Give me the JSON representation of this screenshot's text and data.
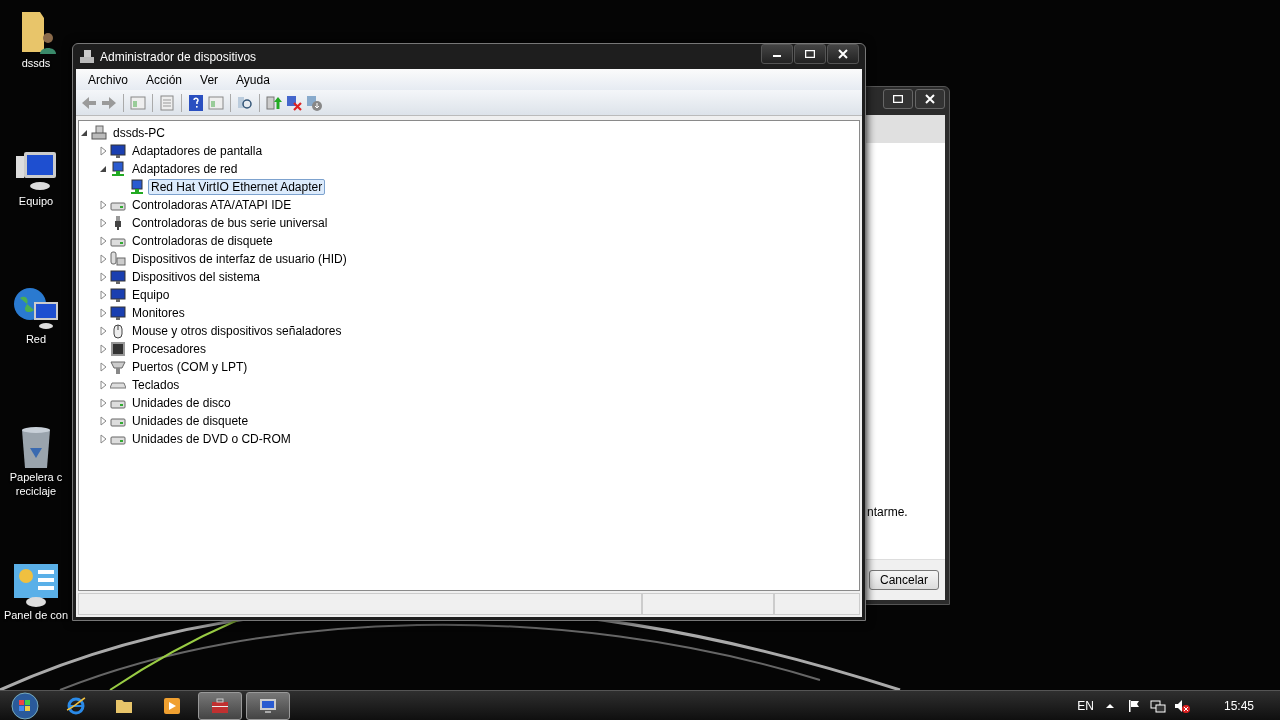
{
  "desktop_icons": [
    {
      "kind": "user-folder",
      "lines": [
        "dssds"
      ]
    },
    {
      "kind": "computer",
      "lines": [
        "Equipo"
      ]
    },
    {
      "kind": "network",
      "lines": [
        "Red"
      ]
    },
    {
      "kind": "recycle-bin",
      "lines": [
        "Papelera c",
        "reciclaje"
      ]
    },
    {
      "kind": "control-panel",
      "lines": [
        "Panel de con"
      ]
    }
  ],
  "dialog_behind": {
    "text": "ntarme.",
    "button": "Cancelar"
  },
  "window": {
    "title": "Administrador de dispositivos",
    "menu": [
      "Archivo",
      "Acción",
      "Ver",
      "Ayuda"
    ],
    "tree": [
      {
        "label": "dssds-PC",
        "kind": "computer",
        "expanded": true,
        "selected": false,
        "children": [
          {
            "label": "Adaptadores de pantalla",
            "kind": "display",
            "expanded": false,
            "selected": false
          },
          {
            "label": "Adaptadores de red",
            "kind": "network",
            "expanded": true,
            "selected": false,
            "children": [
              {
                "label": "Red Hat VirtIO Ethernet Adapter",
                "kind": "network",
                "selected": true
              }
            ]
          },
          {
            "label": "Controladoras ATA/ATAPI IDE",
            "kind": "drive",
            "expanded": false,
            "selected": false
          },
          {
            "label": "Controladoras de bus serie universal",
            "kind": "usb",
            "expanded": false,
            "selected": false
          },
          {
            "label": "Controladoras de disquete",
            "kind": "drive",
            "expanded": false,
            "selected": false
          },
          {
            "label": "Dispositivos de interfaz de usuario (HID)",
            "kind": "hid",
            "expanded": false,
            "selected": false
          },
          {
            "label": "Dispositivos del sistema",
            "kind": "display",
            "expanded": false,
            "selected": false
          },
          {
            "label": "Equipo",
            "kind": "display",
            "expanded": false,
            "selected": false
          },
          {
            "label": "Monitores",
            "kind": "display",
            "expanded": false,
            "selected": false
          },
          {
            "label": "Mouse y otros dispositivos señaladores",
            "kind": "mouse",
            "expanded": false,
            "selected": false
          },
          {
            "label": "Procesadores",
            "kind": "cpu",
            "expanded": false,
            "selected": false
          },
          {
            "label": "Puertos (COM y LPT)",
            "kind": "port",
            "expanded": false,
            "selected": false
          },
          {
            "label": "Teclados",
            "kind": "keyboard",
            "expanded": false,
            "selected": false
          },
          {
            "label": "Unidades de disco",
            "kind": "drive",
            "expanded": false,
            "selected": false
          },
          {
            "label": "Unidades de disquete",
            "kind": "drive",
            "expanded": false,
            "selected": false
          },
          {
            "label": "Unidades de DVD o CD-ROM",
            "kind": "drive",
            "expanded": false,
            "selected": false
          }
        ]
      }
    ]
  },
  "taskbar": {
    "buttons": [
      {
        "kind": "browser",
        "active": false
      },
      {
        "kind": "folder",
        "active": false
      },
      {
        "kind": "media",
        "active": false
      },
      {
        "kind": "toolbox",
        "active": true
      },
      {
        "kind": "monitor",
        "active": true
      }
    ],
    "language": "EN",
    "clock": "15:45"
  }
}
